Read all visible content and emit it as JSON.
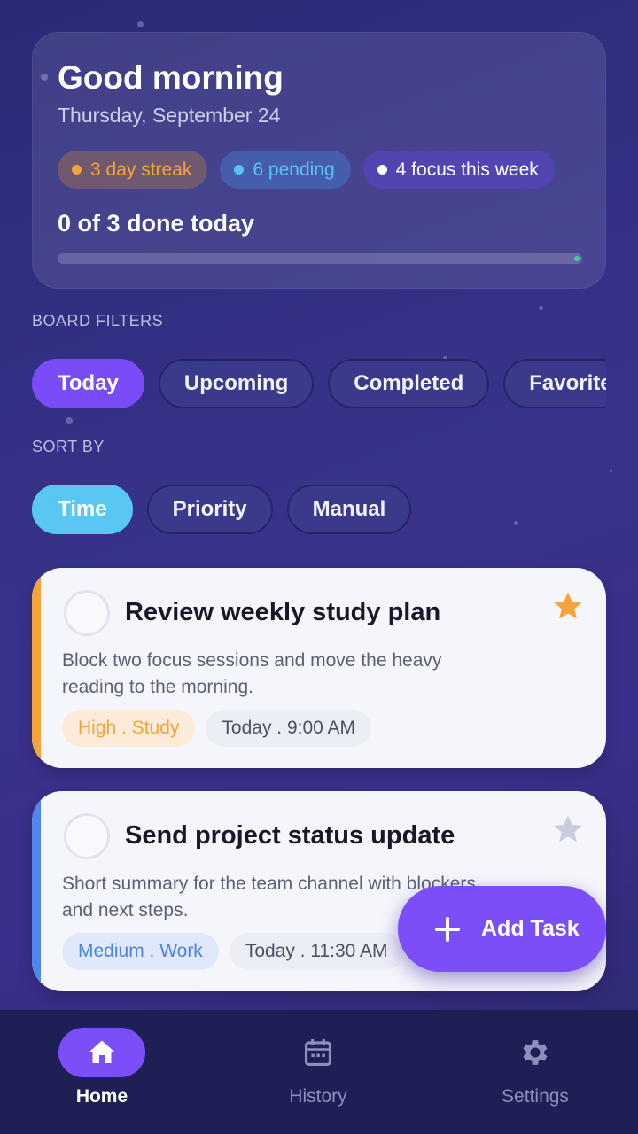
{
  "header": {
    "greeting": "Good morning",
    "date": "Thursday, September 24",
    "chips": {
      "streak": "3 day streak",
      "pending": "6 pending",
      "focus": "4 focus this week"
    },
    "progress_label": "0 of 3 done today",
    "progress_fraction": 0
  },
  "filters": {
    "section_label": "BOARD FILTERS",
    "items": [
      "Today",
      "Upcoming",
      "Completed",
      "Favorites"
    ],
    "active": "Today"
  },
  "sort": {
    "section_label": "SORT BY",
    "items": [
      "Time",
      "Priority",
      "Manual"
    ],
    "active": "Time"
  },
  "tasks": [
    {
      "title": "Review weekly study plan",
      "description": "Block two focus sessions and move the heavy reading to the morning.",
      "priority_tag": "High . Study",
      "time_tag": "Today . 9:00 AM",
      "starred": true,
      "accent": "#f4a43a"
    },
    {
      "title": "Send project status update",
      "description": "Short summary for the team channel with blockers and next steps.",
      "priority_tag": "Medium . Work",
      "time_tag": "Today . 11:30 AM",
      "starred": false,
      "accent": "#4f86ec"
    }
  ],
  "fab": {
    "label": "Add Task"
  },
  "nav": {
    "items": [
      {
        "label": "Home",
        "icon": "home-icon"
      },
      {
        "label": "History",
        "icon": "calendar-icon"
      },
      {
        "label": "Settings",
        "icon": "gear-icon"
      }
    ],
    "active": "Home"
  },
  "colors": {
    "accent_purple": "#7b4ef8",
    "accent_cyan": "#58c8f2",
    "streak_orange": "#f5a33b",
    "pending_blue": "#58c4f5"
  }
}
